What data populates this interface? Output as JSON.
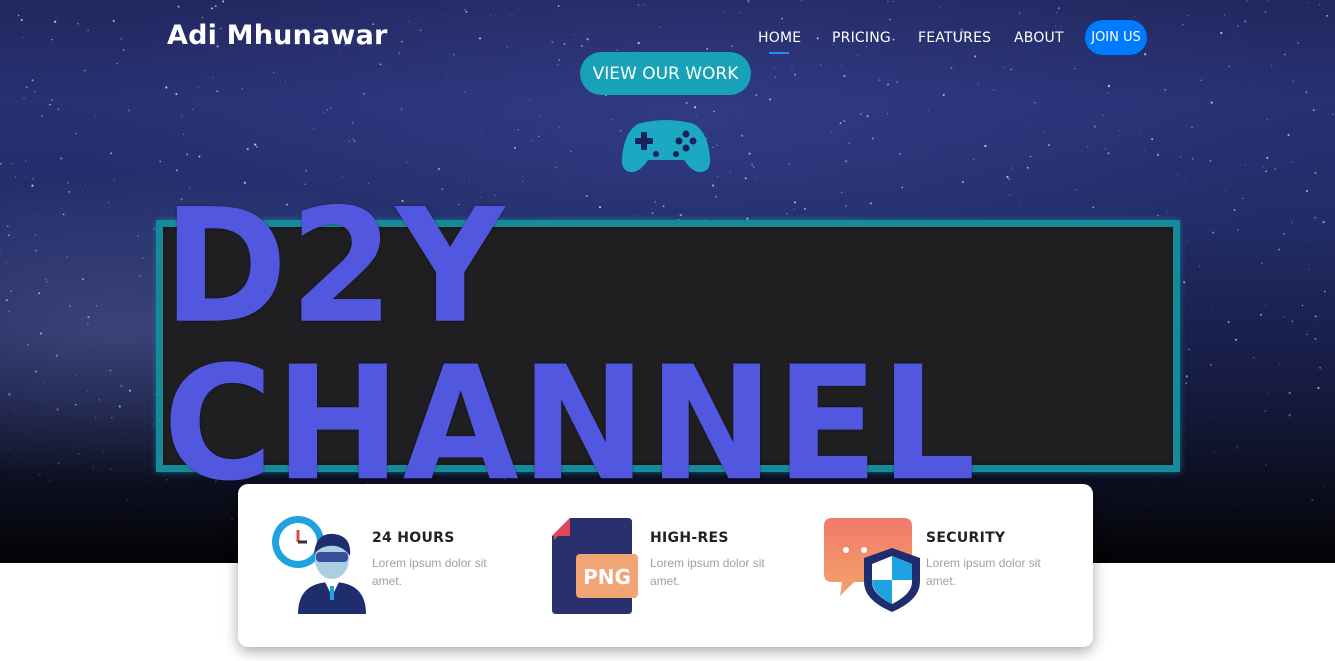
{
  "header": {
    "brand": "Adi Mhunawar",
    "nav": [
      {
        "label": "HOME",
        "active": true
      },
      {
        "label": "PRICING"
      },
      {
        "label": "FEATURES"
      },
      {
        "label": "ABOUT"
      }
    ],
    "join_label": "JOIN US"
  },
  "hero": {
    "cta_label": "VIEW OUR WORK",
    "icon": "gamepad-icon",
    "banner_text": "D2Y CHANNEL"
  },
  "features": [
    {
      "title": "24 HOURS",
      "text": "Lorem ipsum dolor sit amet.",
      "icon": "clock-person-icon"
    },
    {
      "title": "HIGH-RES",
      "text": "Lorem ipsum dolor sit amet.",
      "icon": "png-file-icon"
    },
    {
      "title": "SECURITY",
      "text": "Lorem ipsum dolor sit amet.",
      "icon": "shield-chat-icon"
    }
  ],
  "colors": {
    "accent_blue": "#007bff",
    "cta_teal": "#17a2b8",
    "banner_text": "#5257df",
    "banner_border": "#158a9a"
  }
}
